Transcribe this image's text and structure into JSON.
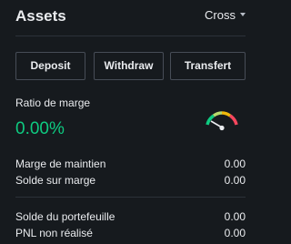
{
  "header": {
    "title": "Assets",
    "margin_mode": "Cross"
  },
  "buttons": {
    "deposit": "Deposit",
    "withdraw": "Withdraw",
    "transfer": "Transfert"
  },
  "margin_ratio": {
    "label": "Ratio de marge",
    "value": "0.00%",
    "value_color": "#0ecb81"
  },
  "margin_details": [
    {
      "label": "Marge de maintien",
      "value": "0.00"
    },
    {
      "label": "Solde sur marge",
      "value": "0.00"
    }
  ],
  "portfolio_details": [
    {
      "label": "Solde du portefeuille",
      "value": "0.00"
    },
    {
      "label": "PNL non réalisé",
      "value": "0.00"
    }
  ],
  "icons": {
    "gauge": "margin-ratio-gauge-icon",
    "caret": "chevron-down-icon"
  }
}
